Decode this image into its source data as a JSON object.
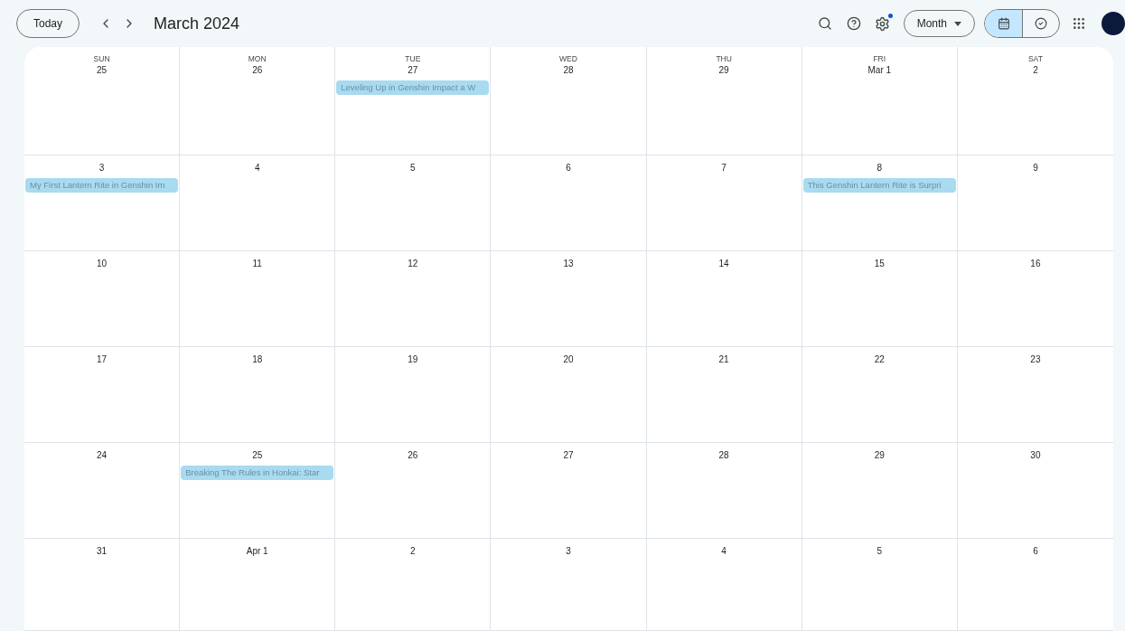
{
  "toolbar": {
    "today_button": "Today",
    "title": "March 2024",
    "view_select": "Month",
    "settings_badge": true,
    "view_toggle": [
      {
        "kind": "calendar",
        "selected": true
      },
      {
        "kind": "tasks",
        "selected": false
      }
    ]
  },
  "weekdays": [
    "SUN",
    "MON",
    "TUE",
    "WED",
    "THU",
    "FRI",
    "SAT"
  ],
  "weeks": [
    [
      {
        "date": "25"
      },
      {
        "date": "26"
      },
      {
        "date": "27",
        "events": [
          "Leveling Up in Genshin Impact a W"
        ]
      },
      {
        "date": "28"
      },
      {
        "date": "29"
      },
      {
        "date": "Mar 1"
      },
      {
        "date": "2"
      }
    ],
    [
      {
        "date": "3",
        "events": [
          "My First Lantern Rite in Genshin Im"
        ]
      },
      {
        "date": "4"
      },
      {
        "date": "5"
      },
      {
        "date": "6"
      },
      {
        "date": "7"
      },
      {
        "date": "8",
        "events": [
          "This Genshin Lantern Rite is Surpri"
        ]
      },
      {
        "date": "9"
      }
    ],
    [
      {
        "date": "10"
      },
      {
        "date": "11"
      },
      {
        "date": "12"
      },
      {
        "date": "13"
      },
      {
        "date": "14"
      },
      {
        "date": "15"
      },
      {
        "date": "16"
      }
    ],
    [
      {
        "date": "17"
      },
      {
        "date": "18"
      },
      {
        "date": "19"
      },
      {
        "date": "20"
      },
      {
        "date": "21"
      },
      {
        "date": "22"
      },
      {
        "date": "23"
      }
    ],
    [
      {
        "date": "24"
      },
      {
        "date": "25",
        "events": [
          "Breaking The Rules in Honkai: Star"
        ]
      },
      {
        "date": "26"
      },
      {
        "date": "27"
      },
      {
        "date": "28"
      },
      {
        "date": "29"
      },
      {
        "date": "30"
      }
    ],
    [
      {
        "date": "31"
      },
      {
        "date": "Apr 1"
      },
      {
        "date": "2"
      },
      {
        "date": "3"
      },
      {
        "date": "4"
      },
      {
        "date": "5"
      },
      {
        "date": "6"
      }
    ]
  ]
}
